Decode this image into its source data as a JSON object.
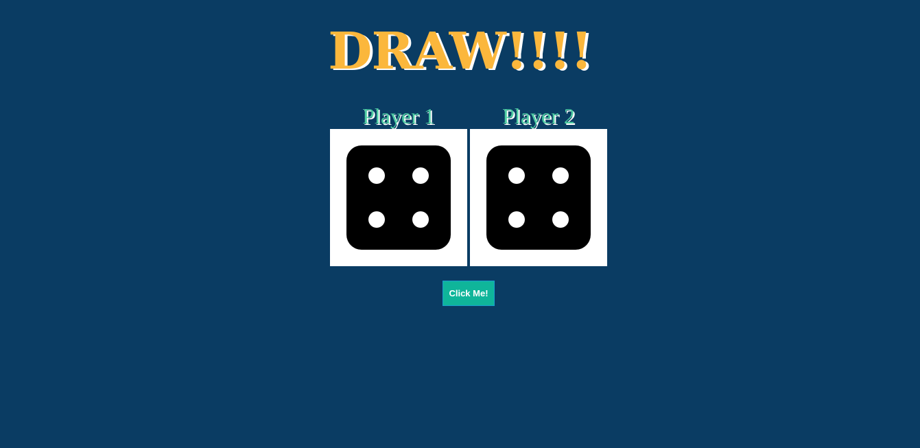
{
  "heading": "DRAW!!!!",
  "players": [
    {
      "name": "Player 1",
      "die_value": 4
    },
    {
      "name": "Player 2",
      "die_value": 4
    }
  ],
  "roll_button_label": "Click Me!",
  "colors": {
    "background": "#0a3c63",
    "heading": "#fbb73c",
    "player_name": "#4ecca3",
    "button": "#0fb59a"
  }
}
